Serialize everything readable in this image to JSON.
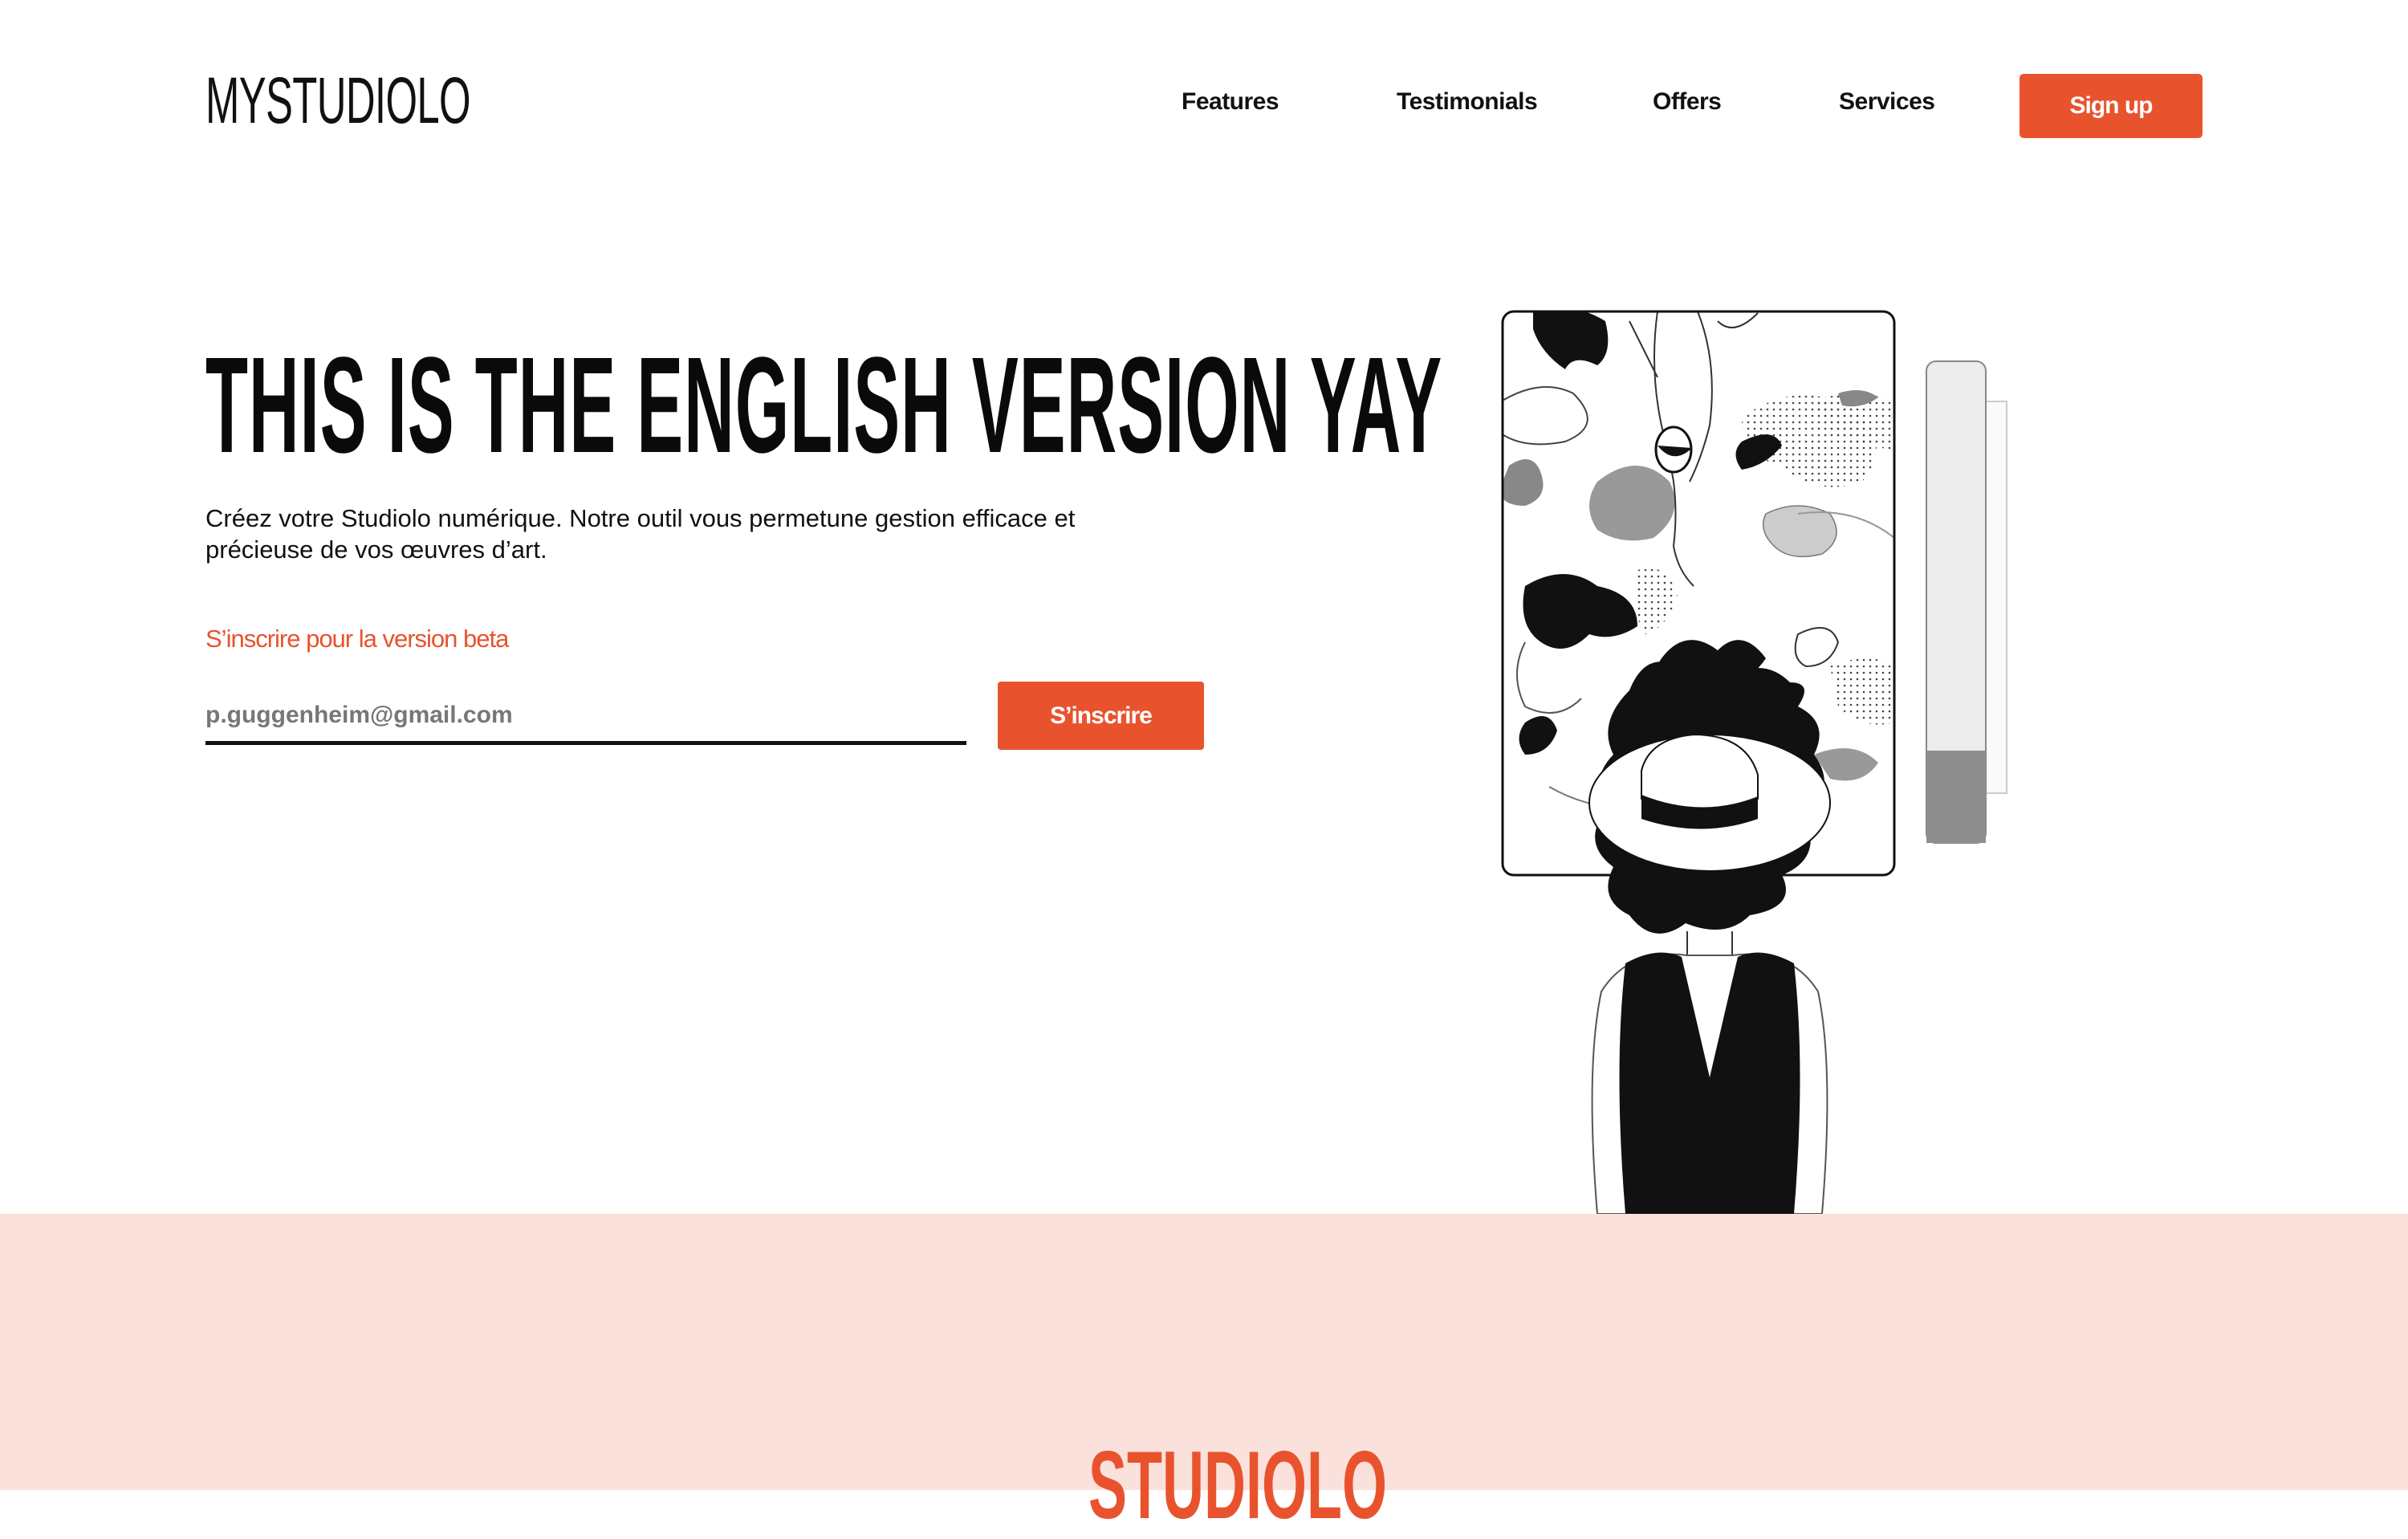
{
  "colors": {
    "accent": "#E8532E",
    "text": "#111111",
    "placeholder": "#777777",
    "section_bg": "#FBE1DB"
  },
  "header": {
    "logo_prefix": "MY",
    "logo_main": "STUDIOLO",
    "nav": [
      "Features",
      "Testimonials",
      "Offers",
      "Services"
    ],
    "signup_label": "Sign up"
  },
  "hero": {
    "title": "THIS IS THE ENGLISH VERSION YAY",
    "description": "Créez votre Studiolo numérique. Notre outil vous permetune gestion efficace et précieuse de vos œuvres d’art.",
    "beta_label": "S’inscrire pour la version beta",
    "email_value": "p.guggenheim@gmail.com",
    "email_placeholder": "p.guggenheim@gmail.com",
    "subscribe_label": "S’inscrire"
  },
  "section2": {
    "title": "STUDIOLO"
  },
  "illustration": {
    "icon": "person-viewing-artwork-illustration"
  }
}
